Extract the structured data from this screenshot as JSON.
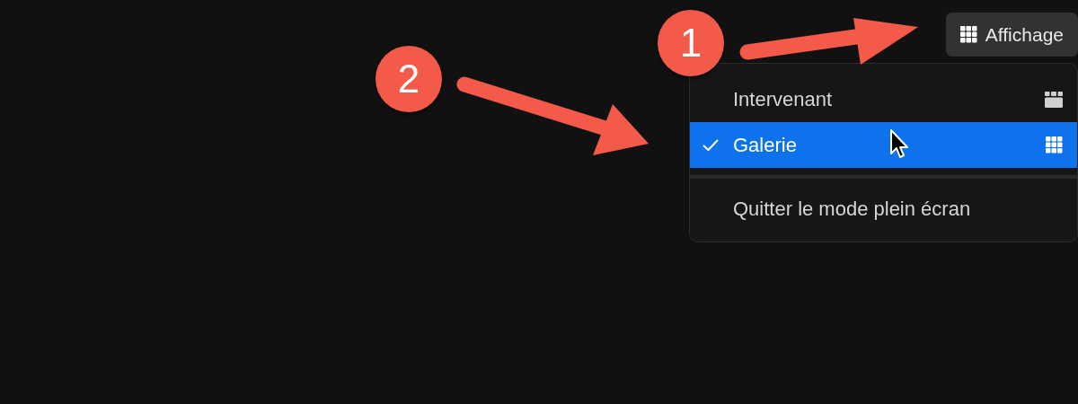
{
  "view_button": {
    "label": "Affichage"
  },
  "menu": {
    "items": [
      {
        "kind": "view",
        "label": "Intervenant",
        "selected": false
      },
      {
        "kind": "view",
        "label": "Galerie",
        "selected": true
      },
      {
        "kind": "separator"
      },
      {
        "kind": "action",
        "label": "Quitter le mode plein écran"
      }
    ]
  },
  "annotations": [
    {
      "number": "1"
    },
    {
      "number": "2"
    }
  ]
}
